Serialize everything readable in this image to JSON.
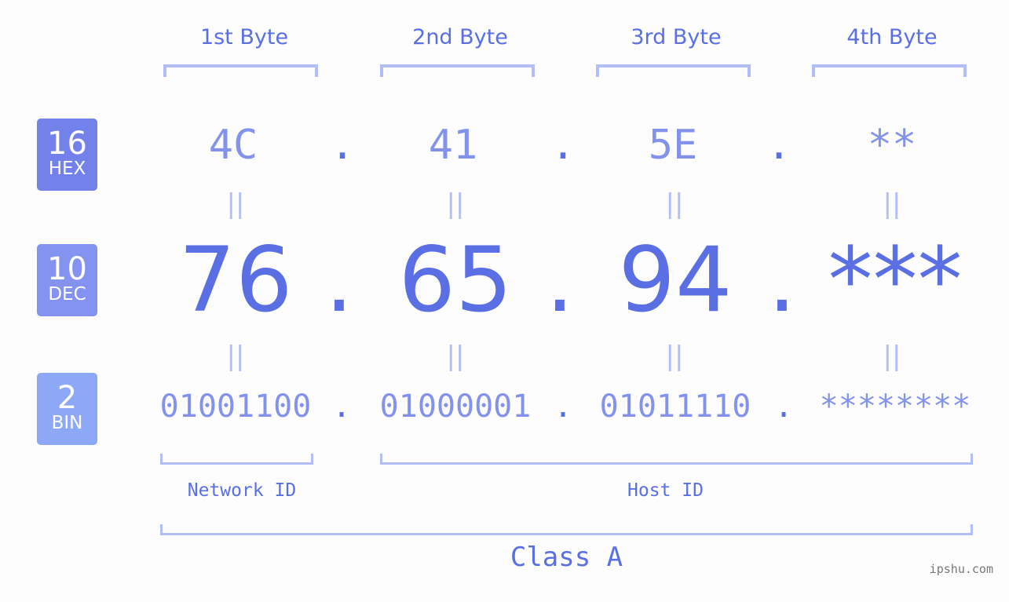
{
  "byte_headers": [
    "1st Byte",
    "2nd Byte",
    "3rd Byte",
    "4th Byte"
  ],
  "badges": {
    "hex": {
      "number": "16",
      "label": "HEX",
      "color": "#7382ea"
    },
    "dec": {
      "number": "10",
      "label": "DEC",
      "color": "#8393ef"
    },
    "bin": {
      "number": "2",
      "label": "BIN",
      "color": "#8ea8f8"
    }
  },
  "hex_values": [
    "4C",
    "41",
    "5E",
    "**"
  ],
  "dec_values": [
    "76",
    "65",
    "94",
    "***"
  ],
  "bin_values": [
    "01001100",
    "01000001",
    "01011110",
    "********"
  ],
  "separator": ".",
  "equals_symbol": "||",
  "network_id_label": "Network ID",
  "host_id_label": "Host ID",
  "class_label": "Class A",
  "watermark": "ipshu.com",
  "colors": {
    "accent": "#5a6fe3",
    "light": "#8393ec",
    "bracket": "#b3bdf6"
  }
}
